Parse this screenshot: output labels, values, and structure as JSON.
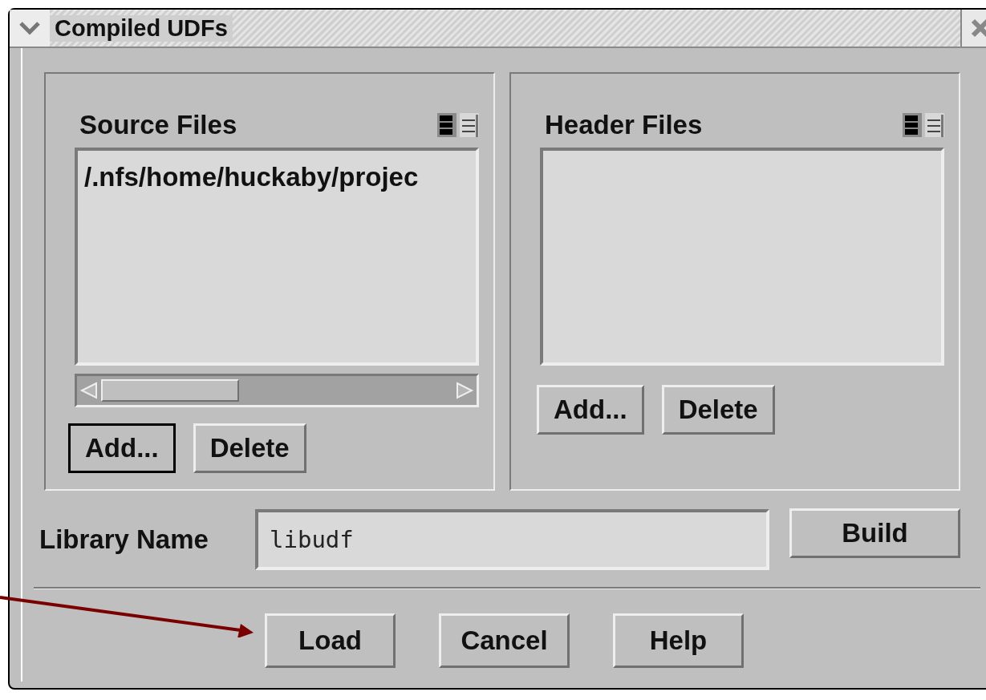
{
  "window": {
    "title": "Compiled UDFs"
  },
  "panels": [
    {
      "title": "Source Files",
      "files": [
        "/.nfs/home/huckaby/projec"
      ],
      "scrollbar": true,
      "buttons": [
        {
          "label": "Add...",
          "default": true
        },
        {
          "label": "Delete",
          "default": false
        }
      ]
    },
    {
      "title": "Header Files",
      "scrollbar": false,
      "buttons": [
        {
          "label": "Add...",
          "default": false
        },
        {
          "label": "Delete",
          "default": false
        }
      ]
    }
  ],
  "library": {
    "label": "Library Name",
    "value": "libudf",
    "button": "Build"
  },
  "buttons": [
    "Load",
    "Cancel",
    "Help"
  ]
}
